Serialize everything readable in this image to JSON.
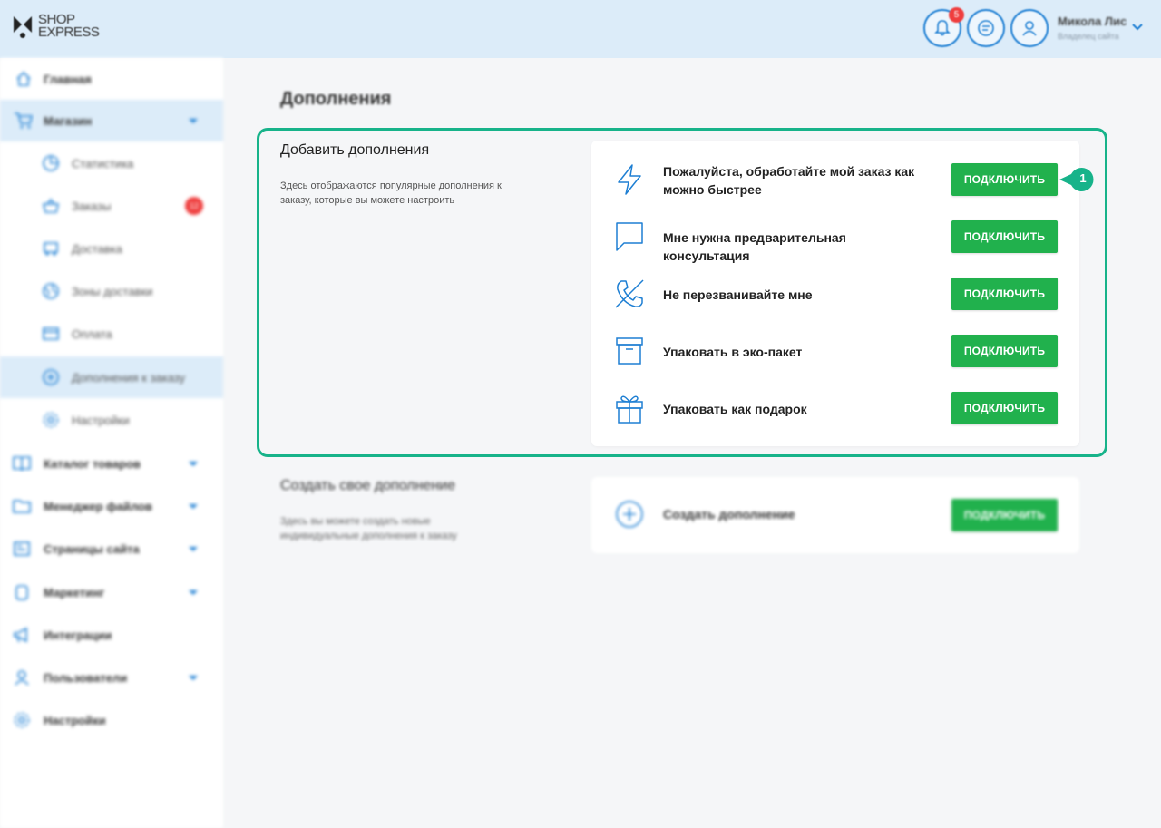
{
  "header": {
    "logo_line1": "SHOP",
    "logo_line2": "EXPRESS",
    "notifications_count": "5",
    "user_name": "Микола Лис",
    "user_role": "Владелец сайта"
  },
  "sidebar": {
    "items": [
      {
        "label": "Главная",
        "icon": "home-icon"
      },
      {
        "label": "Магазин",
        "icon": "cart-icon"
      },
      {
        "label": "Статистика",
        "icon": "pie-chart-icon"
      },
      {
        "label": "Заказы",
        "icon": "basket-icon",
        "badge": "12"
      },
      {
        "label": "Доставка",
        "icon": "truck-icon"
      },
      {
        "label": "Зоны доставки",
        "icon": "globe-icon"
      },
      {
        "label": "Оплата",
        "icon": "credit-card-icon"
      },
      {
        "label": "Дополнения к заказу",
        "icon": "plus-circle-icon"
      },
      {
        "label": "Настройки",
        "icon": "gear-icon"
      },
      {
        "label": "Каталог товаров",
        "icon": "book-icon"
      },
      {
        "label": "Менеджер файлов",
        "icon": "folder-icon"
      },
      {
        "label": "Страницы сайта",
        "icon": "pages-icon"
      },
      {
        "label": "Маркетинг",
        "icon": "marketing-icon"
      },
      {
        "label": "Интеграции",
        "icon": "megaphone-icon"
      },
      {
        "label": "Пользователи",
        "icon": "user-icon"
      },
      {
        "label": "Настройки",
        "icon": "gear-icon"
      }
    ]
  },
  "main": {
    "page_title": "Дополнения",
    "add_section": {
      "title": "Добавить дополнения",
      "description": "Здесь отображаются популярные дополнения к заказу, которые вы можете настроить",
      "rows": [
        {
          "label": "Пожалуйста, обработайте мой заказ как можно быстрее",
          "icon": "lightning-icon",
          "button": "ПОДКЛЮЧИТЬ"
        },
        {
          "label": "Мне нужна предварительная консультация",
          "icon": "chat-bubble-icon",
          "button": "ПОДКЛЮЧИТЬ"
        },
        {
          "label": "Не перезванивайте мне",
          "icon": "phone-off-icon",
          "button": "ПОДКЛЮЧИТЬ"
        },
        {
          "label": "Упаковать в эко-пакет",
          "icon": "box-icon",
          "button": "ПОДКЛЮЧИТЬ"
        },
        {
          "label": "Упаковать как подарок",
          "icon": "gift-icon",
          "button": "ПОДКЛЮЧИТЬ"
        }
      ]
    },
    "create_section": {
      "title": "Создать свое дополнение",
      "description": "Здесь вы можете создать новые индивидуальные дополнения к заказу",
      "row_label": "Создать дополнение",
      "button": "ПОДКЛЮЧИТЬ"
    },
    "callout_number": "1"
  },
  "colors": {
    "accent_blue": "#1e7fd3",
    "button_green": "#21b14d",
    "highlight_teal": "#17b38a",
    "badge_red": "#ef3e3e"
  }
}
